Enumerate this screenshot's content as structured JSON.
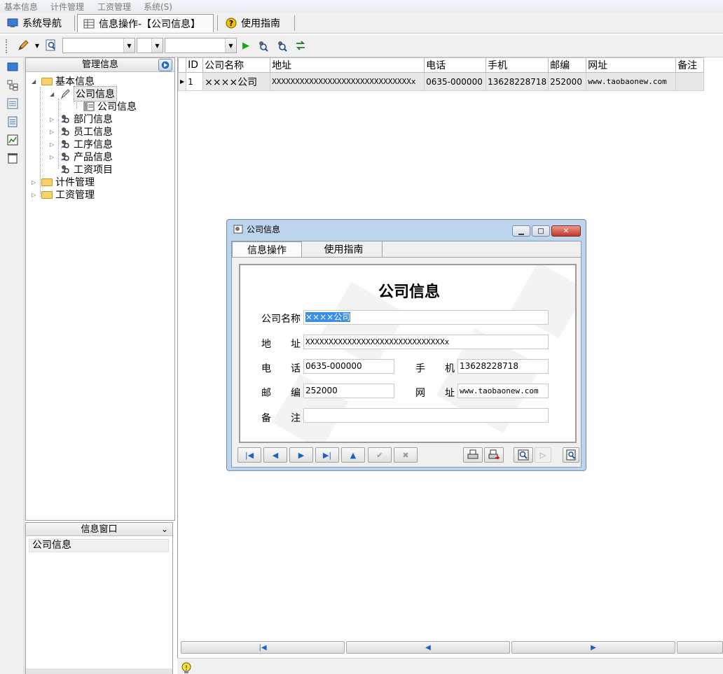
{
  "menu": [
    "基本信息",
    "计件管理",
    "工资管理",
    "系统(S)"
  ],
  "tabs": [
    {
      "label": "系统导航"
    },
    {
      "label": "信息操作-【公司信息】"
    },
    {
      "label": "使用指南"
    }
  ],
  "tree": {
    "header": "管理信息",
    "nodes": {
      "basic": "基本信息",
      "company": "公司信息",
      "company_sub": "公司信息",
      "dept": "部门信息",
      "employee": "员工信息",
      "process": "工序信息",
      "product": "产品信息",
      "wage_item": "工资项目",
      "piecework": "计件管理",
      "wage_mgmt": "工资管理"
    }
  },
  "info_window": {
    "title": "信息窗口",
    "item": "公司信息"
  },
  "grid": {
    "headers": [
      "ID",
      "公司名称",
      "地址",
      "电话",
      "手机",
      "邮编",
      "网址",
      "备注"
    ],
    "row": {
      "id": "1",
      "name": "××××公司",
      "address": "XXXXXXXXXXXXXXXXXXXXXXXXXXXXXXx",
      "phone": "0635-000000",
      "mobile": "13628228718",
      "zip": "252000",
      "url": "www.taobaonew.com",
      "note": ""
    }
  },
  "dialog": {
    "title": "公司信息",
    "tabs": [
      "信息操作",
      "使用指南"
    ],
    "form_title": "公司信息",
    "labels": {
      "name": "公司名称",
      "addr1": "地",
      "addr2": "址",
      "phone1": "电",
      "phone2": "话",
      "mobile1": "手",
      "mobile2": "机",
      "zip1": "邮",
      "zip2": "编",
      "url1": "网",
      "url2": "址",
      "note1": "备",
      "note2": "注"
    },
    "values": {
      "name": "××××公司",
      "address": "XXXXXXXXXXXXXXXXXXXXXXXXXXXXXXx",
      "phone": "0635-000000",
      "mobile": "13628228718",
      "zip": "252000",
      "url": "www.taobaonew.com",
      "note": ""
    }
  },
  "colors": {
    "accent": "#1b62c4",
    "selection": "#3a8ee6",
    "dialog_frame": "#bcd4ec"
  }
}
